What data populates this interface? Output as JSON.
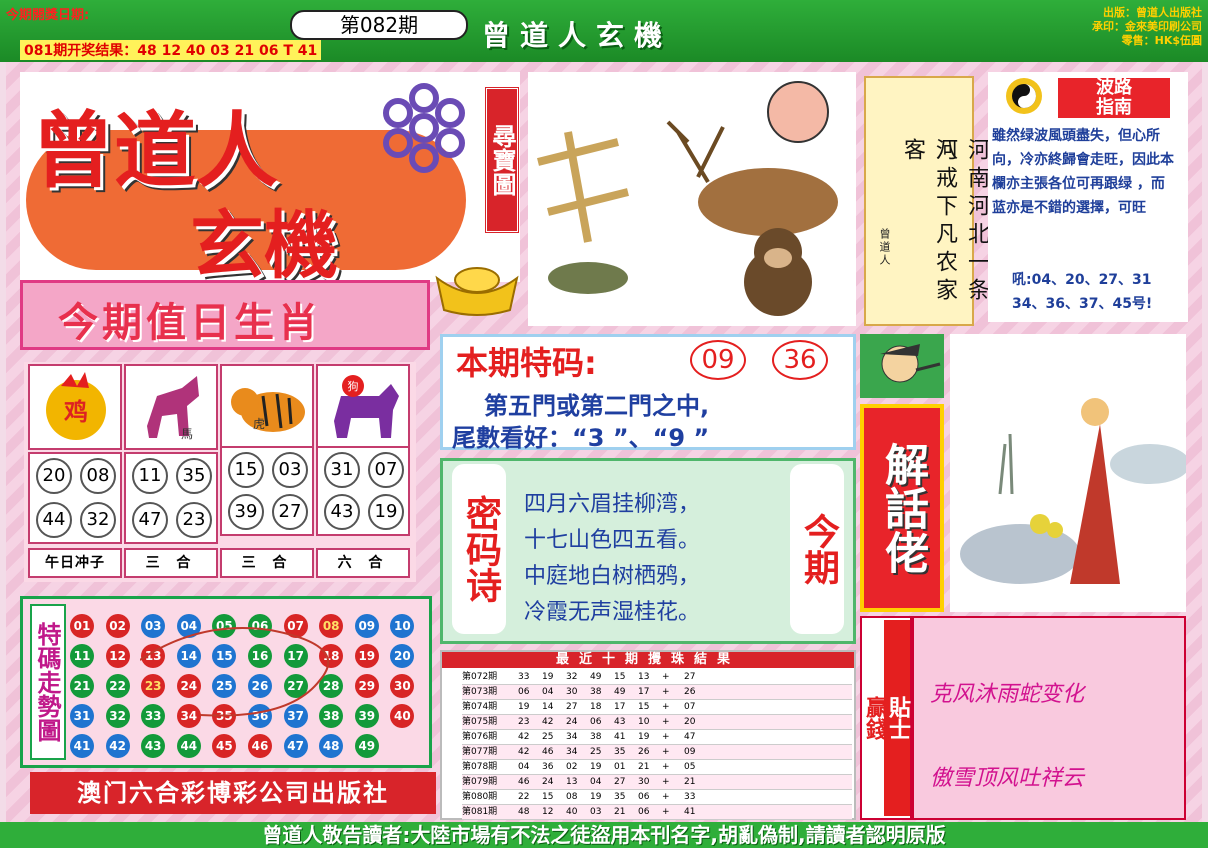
{
  "header": {
    "issue_date_label": "今期開獎日期:",
    "last_result": "081期开奖结果：48 12 40 03 21 06 T 41",
    "issue": "第082期",
    "title": "曾道人玄機",
    "publisher_lines": [
      "出版：曾道人出版社",
      "承印：金來美印刷公司",
      "零售：HK$伍圓"
    ]
  },
  "logo": {
    "main": "曾道人",
    "sub": "玄機",
    "treasure_map": "尋寶圖"
  },
  "zodiac": {
    "title": "今期值日生肖",
    "animals": [
      {
        "name": "鸡",
        "icon": "rooster-icon",
        "numbers": [
          "20",
          "08",
          "44",
          "32"
        ],
        "label": "午日冲子"
      },
      {
        "name": "馬",
        "icon": "horse-icon",
        "numbers": [
          "11",
          "35",
          "47",
          "23"
        ],
        "label": "三 合"
      },
      {
        "name": "虎",
        "icon": "tiger-icon",
        "numbers": [
          "15",
          "03",
          "39",
          "27"
        ],
        "label": "三 合"
      },
      {
        "name": "狗",
        "icon": "dog-icon",
        "numbers": [
          "31",
          "07",
          "43",
          "19"
        ],
        "label": "六 合"
      }
    ]
  },
  "trend": {
    "title": "特碼走勢圖",
    "balls": [
      [
        "01",
        "r"
      ],
      [
        "02",
        "r"
      ],
      [
        "03",
        "b"
      ],
      [
        "04",
        "b"
      ],
      [
        "05",
        "g"
      ],
      [
        "06",
        "g"
      ],
      [
        "07",
        "r"
      ],
      [
        "08",
        "rt"
      ],
      [
        "09",
        "b"
      ],
      [
        "10",
        "b"
      ],
      [
        "11",
        "g"
      ],
      [
        "12",
        "r"
      ],
      [
        "13",
        "r"
      ],
      [
        "14",
        "b"
      ],
      [
        "15",
        "b"
      ],
      [
        "16",
        "g"
      ],
      [
        "17",
        "g"
      ],
      [
        "18",
        "r"
      ],
      [
        "19",
        "r"
      ],
      [
        "20",
        "b"
      ],
      [
        "21",
        "g"
      ],
      [
        "22",
        "g"
      ],
      [
        "23",
        "rt"
      ],
      [
        "24",
        "r"
      ],
      [
        "25",
        "b"
      ],
      [
        "26",
        "b"
      ],
      [
        "27",
        "g"
      ],
      [
        "28",
        "g"
      ],
      [
        "29",
        "r"
      ],
      [
        "30",
        "r"
      ],
      [
        "31",
        "b"
      ],
      [
        "32",
        "g"
      ],
      [
        "33",
        "g"
      ],
      [
        "34",
        "r"
      ],
      [
        "35",
        "r"
      ],
      [
        "36",
        "b"
      ],
      [
        "37",
        "b"
      ],
      [
        "38",
        "g"
      ],
      [
        "39",
        "g"
      ],
      [
        "40",
        "r"
      ],
      [
        "41",
        "b"
      ],
      [
        "42",
        "b"
      ],
      [
        "43",
        "g"
      ],
      [
        "44",
        "g"
      ],
      [
        "45",
        "r"
      ],
      [
        "46",
        "r"
      ],
      [
        "47",
        "b"
      ],
      [
        "48",
        "b"
      ],
      [
        "49",
        "g"
      ]
    ]
  },
  "publisher": "澳门六合彩博彩公司出版社",
  "poem_panel": {
    "col1": "河南河北一条河",
    "col2": "八戒下凡农家客",
    "sign": "曾道人"
  },
  "wave": {
    "title_line1": "波路",
    "title_line2": "指南",
    "text": "雖然绿波風頭盡失，但心所向，冷亦終歸會走旺，因此本欄亦主張各位可再跟绿 ，而 蓝亦是不錯的選擇，可旺",
    "nums1": "吼:04、20、27、31",
    "nums2": "34、36、37、45号!"
  },
  "special": {
    "title": "本期特码:",
    "ball1": "09",
    "ball2": "36",
    "line1": "第五門或第二門之中,",
    "line2": "尾數看好：“3 ”、“9 ”"
  },
  "code_poem": {
    "left": "密码诗",
    "right": "今期",
    "lines": [
      "四月六眉挂柳湾，",
      "十七山色四五看。",
      "中庭地白树栖鸦，",
      "冷霞无声湿桂花。"
    ]
  },
  "results": {
    "title": "最近十期攪珠結果",
    "rows": [
      [
        "第072期",
        "33",
        "19",
        "32",
        "49",
        "15",
        "13",
        "+",
        "27"
      ],
      [
        "第073期",
        "06",
        "04",
        "30",
        "38",
        "49",
        "17",
        "+",
        "26"
      ],
      [
        "第074期",
        "19",
        "14",
        "27",
        "18",
        "17",
        "15",
        "+",
        "07"
      ],
      [
        "第075期",
        "23",
        "42",
        "24",
        "06",
        "43",
        "10",
        "+",
        "20"
      ],
      [
        "第076期",
        "42",
        "25",
        "34",
        "38",
        "41",
        "19",
        "+",
        "47"
      ],
      [
        "第077期",
        "42",
        "46",
        "34",
        "25",
        "35",
        "26",
        "+",
        "09"
      ],
      [
        "第078期",
        "04",
        "36",
        "02",
        "19",
        "01",
        "21",
        "+",
        "05"
      ],
      [
        "第079期",
        "46",
        "24",
        "13",
        "04",
        "27",
        "30",
        "+",
        "21"
      ],
      [
        "第080期",
        "22",
        "15",
        "08",
        "19",
        "35",
        "06",
        "+",
        "33"
      ],
      [
        "第081期",
        "48",
        "12",
        "40",
        "03",
        "21",
        "06",
        "+",
        "41"
      ]
    ]
  },
  "jiehua": "解話佬",
  "money": {
    "a": "贏錢",
    "b": "貼士"
  },
  "tips": [
    "克风沐雨蛇变化",
    "傲雪顶风吐祥云"
  ],
  "bottom_notice": "曾道人敬告讀者:大陸市場有不法之徒盜用本刊名字,胡亂偽制,請讀者認明原版"
}
